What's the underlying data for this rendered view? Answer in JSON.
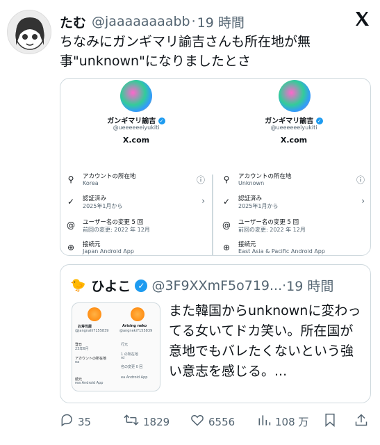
{
  "tweet": {
    "author_name": "たむ",
    "author_handle": "@jaaaaaaaabb",
    "separator": "·",
    "time": "19 時間",
    "text": "ちなみにガンギマリ諭吉さんも所在地が無事\"unknown\"になりましたとさ"
  },
  "attached_image": {
    "left": {
      "name": "ガンギマリ諭吉",
      "handle": "@ueeeeeeiyukiti",
      "domain": "X.com",
      "rows": [
        {
          "label": "アカウントの所在地",
          "value": "Korea",
          "icon": "location-pin-icon",
          "right": "ⓘ"
        },
        {
          "label": "認証済み",
          "value": "2025年1月から",
          "icon": "verified-check-icon",
          "right": "›"
        },
        {
          "label": "ユーザー名の変更 5 回",
          "value": "前回の変更: 2022 年 12月",
          "icon": "at-icon",
          "right": ""
        },
        {
          "label": "接続元",
          "value": "Japan Android App",
          "icon": "globe-icon",
          "right": ""
        }
      ]
    },
    "right": {
      "name": "ガンギマリ諭吉",
      "handle": "@ueeeeeeiyukiti",
      "domain": "X.com",
      "rows": [
        {
          "label": "アカウントの所在地",
          "value": "Unknown",
          "icon": "location-pin-icon",
          "right": "ⓘ"
        },
        {
          "label": "認証済み",
          "value": "2025年1月から",
          "icon": "verified-check-icon",
          "right": "›"
        },
        {
          "label": "ユーザー名の変更 5 回",
          "value": "前回の変更: 2022 年 12月",
          "icon": "at-icon",
          "right": ""
        },
        {
          "label": "接続元",
          "value": "East Asia & Pacific Android App",
          "icon": "globe-icon",
          "right": ""
        }
      ]
    }
  },
  "quote": {
    "name": "ひよこ",
    "handle": "@3F9XXmF5o719...",
    "separator": "·",
    "time": "19 時間",
    "text": "また韓国からunknownに変わってる女いてドカ笑い。所在国が意地でもバレたくないという強い意志を感じる。...",
    "thumb": {
      "name1": "お寿司屋",
      "handle1": "@jangnalli7155839",
      "name2": "Arising neko",
      "handle2": "@angneki7155839",
      "t_a": "登日",
      "t_b": "23年6月",
      "t_c": "アカウントの所在地",
      "t_d": "ea",
      "t_e": "続元",
      "t_f": "rea Android App",
      "r_a": "行元",
      "r_b": "1 の所在地",
      "r_c": "rd",
      "r_d": "名の変更 0 回",
      "r_e": "ea Android App"
    }
  },
  "actions": {
    "replies": "35",
    "retweets": "1829",
    "likes": "6556",
    "views": "108 万"
  },
  "colors": {
    "accent": "#1d9bf0",
    "muted": "#536471",
    "border": "#cfd9de"
  }
}
